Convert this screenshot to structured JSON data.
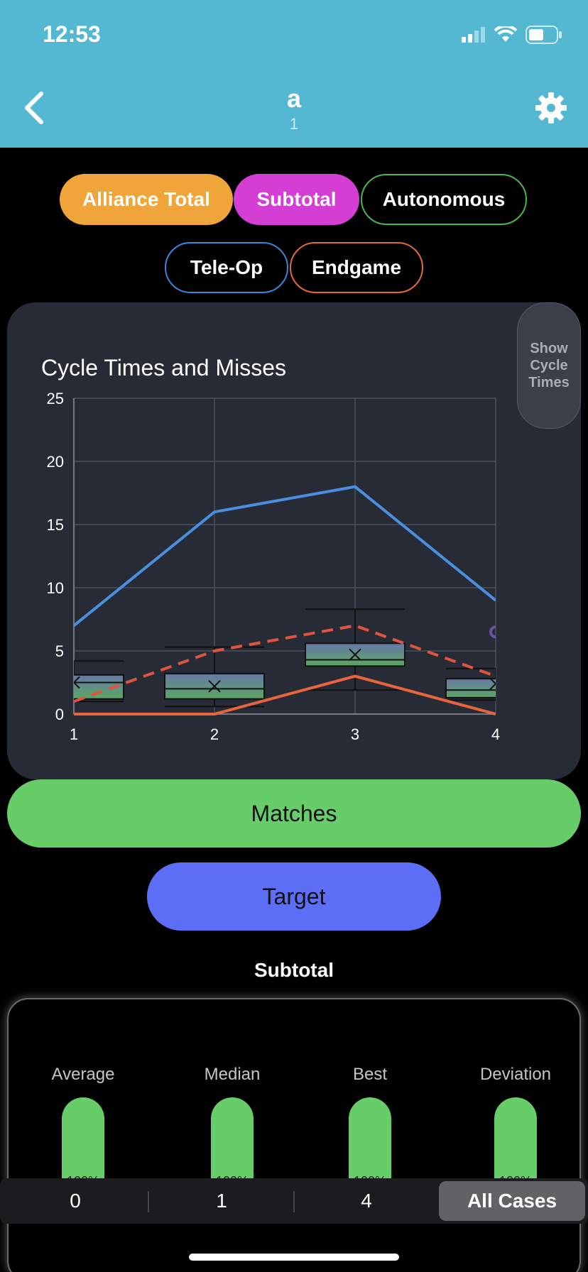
{
  "status_bar": {
    "time": "12:53"
  },
  "header": {
    "title": "a",
    "subtitle": "1"
  },
  "filters": {
    "alliance_total": "Alliance Total",
    "subtotal": "Subtotal",
    "autonomous": "Autonomous",
    "teleop": "Tele-Op",
    "endgame": "Endgame"
  },
  "cycle_toggle": "Show Cycle Times",
  "chart_data": {
    "type": "line",
    "title": "Cycle Times and Misses",
    "x": [
      1,
      2,
      3,
      4
    ],
    "xlim": [
      1,
      4
    ],
    "ylim": [
      0,
      25
    ],
    "y_ticks": [
      0,
      5,
      10,
      15,
      20,
      25
    ],
    "x_ticks": [
      1,
      2,
      3,
      4
    ],
    "grid": true,
    "series": [
      {
        "style": "solid",
        "color": "#4a8ee0",
        "values": [
          7,
          16,
          18,
          9
        ]
      },
      {
        "style": "dashed",
        "color": "#e0533f",
        "values": [
          1,
          5,
          7,
          3
        ]
      },
      {
        "style": "solid",
        "color": "#e8643c",
        "values": [
          0,
          0,
          3,
          0
        ]
      }
    ],
    "boxplots": [
      {
        "x": 1,
        "min": 1.0,
        "q1": 1.2,
        "median": 2.5,
        "q3": 3.1,
        "max": 4.2,
        "mean": 2.5
      },
      {
        "x": 2,
        "min": 0.6,
        "q1": 1.2,
        "median": 2.0,
        "q3": 3.2,
        "max": 5.3,
        "mean": 2.2
      },
      {
        "x": 3,
        "min": 1.9,
        "q1": 3.8,
        "median": 4.3,
        "q3": 5.6,
        "max": 8.3,
        "mean": 4.7
      },
      {
        "x": 4,
        "min": 1.1,
        "q1": 1.3,
        "median": 1.9,
        "q3": 2.8,
        "max": 3.6,
        "mean": 2.4
      }
    ],
    "outliers": [
      {
        "x": 4,
        "y": 6.5
      }
    ]
  },
  "buttons": {
    "matches": "Matches",
    "target": "Target"
  },
  "section_title": "Subtotal",
  "stats": [
    {
      "label": "Average",
      "percent": "100%"
    },
    {
      "label": "Median",
      "percent": "100%"
    },
    {
      "label": "Best",
      "percent": "100%"
    },
    {
      "label": "Deviation",
      "percent": "100%"
    }
  ],
  "segments": [
    "0",
    "1",
    "4",
    "All Cases"
  ],
  "colors": {
    "header": "#54b8d3",
    "card": "#262b36",
    "green": "#66cd68",
    "blue_button": "#5b6ef5"
  }
}
